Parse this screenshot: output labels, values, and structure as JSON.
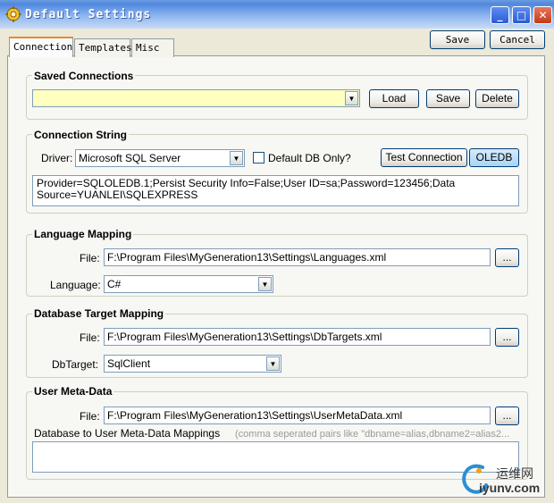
{
  "window": {
    "title": "Default Settings",
    "min_glyph": "_",
    "max_glyph": "□",
    "close_glyph": "✕"
  },
  "toolbar": {
    "save_label": "Save",
    "cancel_label": "Cancel"
  },
  "tabs": [
    {
      "label": "Connection",
      "active": true
    },
    {
      "label": "Templates",
      "active": false
    },
    {
      "label": "Misc",
      "active": false
    }
  ],
  "saved_connections": {
    "title": "Saved Connections",
    "selected": "",
    "load_label": "Load",
    "save_label": "Save",
    "delete_label": "Delete"
  },
  "connection_string": {
    "title": "Connection String",
    "driver_label": "Driver:",
    "driver_value": "Microsoft SQL Server",
    "default_db_only_label": "Default DB Only?",
    "default_db_only_checked": false,
    "test_connection_label": "Test Connection",
    "oledb_label": "OLEDB",
    "value": "Provider=SQLOLEDB.1;Persist Security Info=False;User ID=sa;Password=123456;Data Source=YUANLEI\\SQLEXPRESS"
  },
  "language_mapping": {
    "title": "Language Mapping",
    "file_label": "File:",
    "file_value": "F:\\Program Files\\MyGeneration13\\Settings\\Languages.xml",
    "browse_label": "...",
    "language_label": "Language:",
    "language_value": "C#"
  },
  "db_target_mapping": {
    "title": "Database Target Mapping",
    "file_label": "File:",
    "file_value": "F:\\Program Files\\MyGeneration13\\Settings\\DbTargets.xml",
    "browse_label": "...",
    "dbtarget_label": "DbTarget:",
    "dbtarget_value": "SqlClient"
  },
  "user_meta_data": {
    "title": "User Meta-Data",
    "file_label": "File:",
    "file_value": "F:\\Program Files\\MyGeneration13\\Settings\\UserMetaData.xml",
    "browse_label": "...",
    "mappings_label": "Database to User Meta-Data Mappings",
    "mappings_hint": "(comma seperated pairs like \"dbname=alias,dbname2=alias2...",
    "mappings_value": ""
  },
  "watermark": {
    "cn": "运维网",
    "url": "iyunv.com"
  },
  "colors": {
    "titlebar": "#5087de",
    "tab_highlight": "#e68b2c",
    "saved_field": "#ffffc0",
    "oledb_button": "#a8d4f8"
  }
}
